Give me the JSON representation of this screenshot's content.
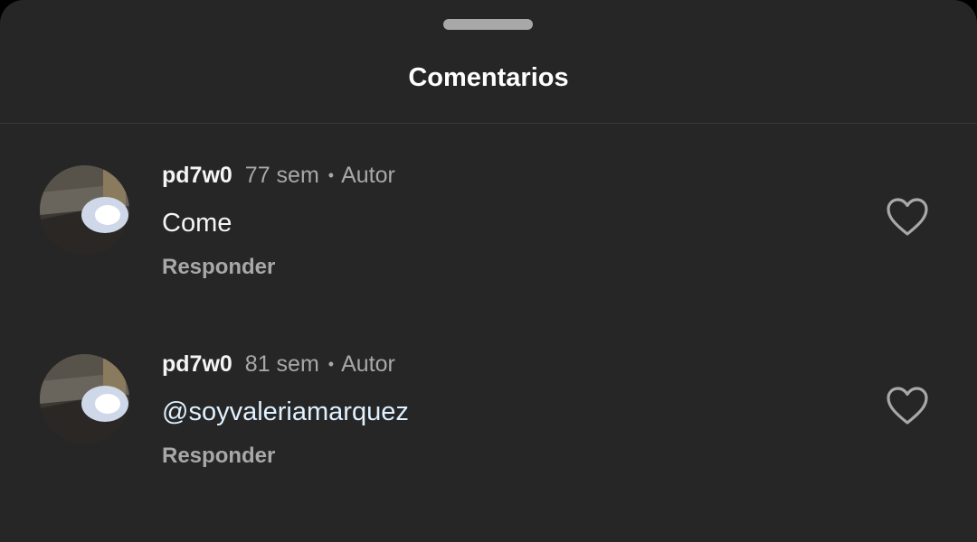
{
  "header": {
    "title": "Comentarios"
  },
  "comments": [
    {
      "username": "pd7w0",
      "time": "77 sem",
      "separator": "•",
      "author_label": "Autor",
      "text": "Come",
      "reply_label": "Responder",
      "like_icon": "heart-outline-icon"
    },
    {
      "username": "pd7w0",
      "time": "81 sem",
      "separator": "•",
      "author_label": "Autor",
      "text": "@soyvaleriamarquez",
      "reply_label": "Responder",
      "like_icon": "heart-outline-icon"
    }
  ],
  "colors": {
    "background": "#262626",
    "primary_text": "#f5f5f5",
    "secondary_text": "#a8a8a8",
    "mention_text": "#e0f1ff",
    "divider": "#383838"
  }
}
